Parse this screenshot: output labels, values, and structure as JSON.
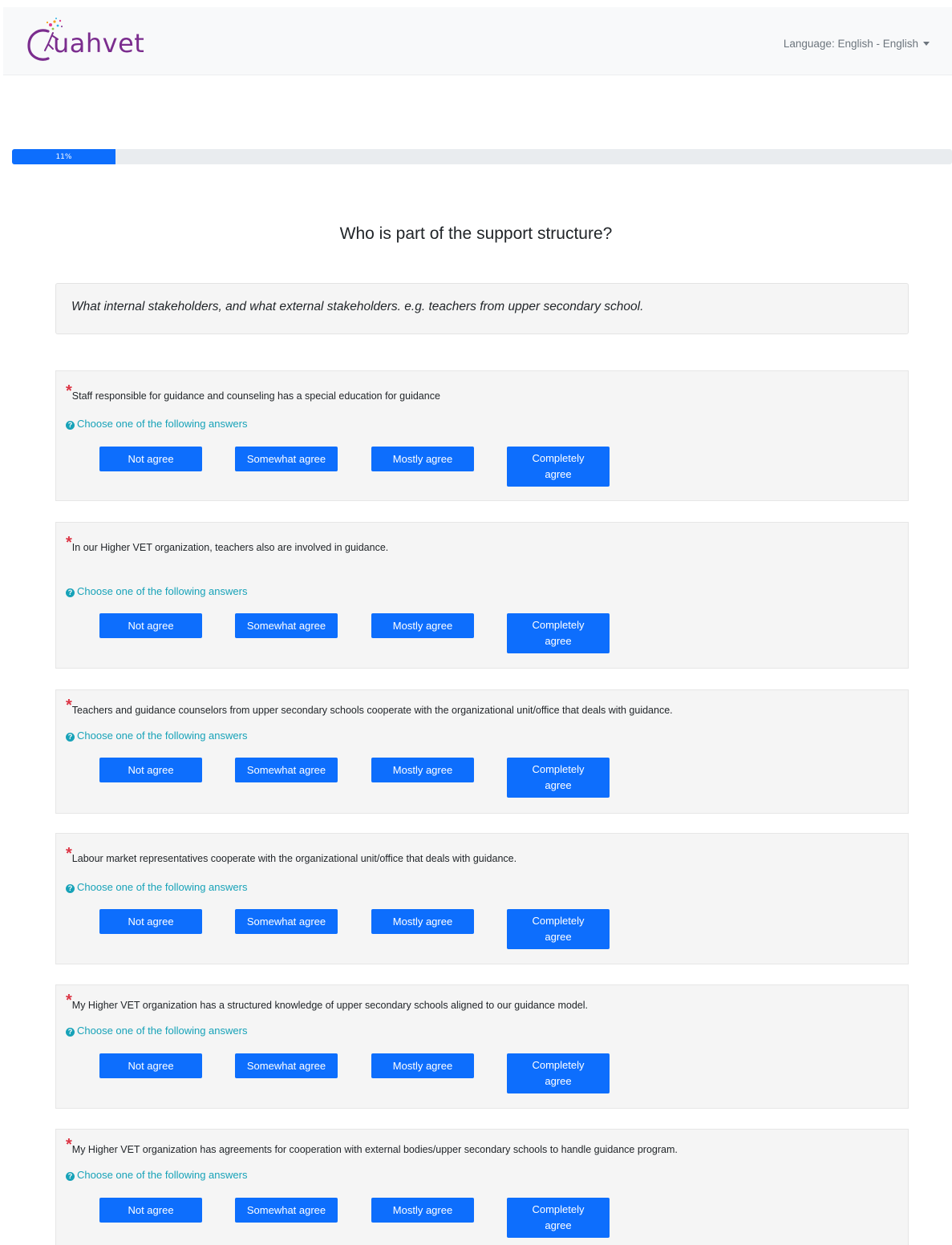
{
  "header": {
    "logo_text": "Quahvet",
    "language_label": "Language: English - English"
  },
  "progress": {
    "label": "11%",
    "percent": 11
  },
  "group": {
    "title": "Who is part of the support structure?",
    "description": "What internal stakeholders, and what external stakeholders. e.g. teachers from upper secondary school."
  },
  "answer_labels": [
    "Not agree",
    "Somewhat agree",
    "Mostly agree",
    "Completely agree"
  ],
  "help_text": "Choose one of the following answers",
  "questions": [
    {
      "required_mark": "*",
      "text": "Staff responsible for guidance and counseling has a special education for guidance",
      "answers": [
        "Not agree",
        "Somewhat agree",
        "Mostly agree",
        "Completely agree"
      ],
      "help": "Choose one of the following answers"
    },
    {
      "required_mark": "*",
      "text": "In our Higher VET organization, teachers also are involved in guidance.",
      "answers": [
        "Not agree",
        "Somewhat agree",
        "Mostly agree",
        "Completely agree"
      ],
      "help": "Choose one of the following answers"
    },
    {
      "required_mark": "*",
      "text": "Teachers and guidance counselors from upper secondary schools cooperate with the organizational unit/office that deals with guidance.",
      "answers": [
        "Not agree",
        "Somewhat agree",
        "Mostly agree",
        "Completely agree"
      ],
      "help": "Choose one of the following answers"
    },
    {
      "required_mark": "*",
      "text": "Labour market representatives cooperate with the organizational unit/office that deals with guidance.",
      "answers": [
        "Not agree",
        "Somewhat agree",
        "Mostly agree",
        "Completely agree"
      ],
      "help": "Choose one of the following answers"
    },
    {
      "required_mark": "*",
      "text": "My Higher VET organization has a structured knowledge of upper secondary schools aligned to our guidance model.",
      "answers": [
        "Not agree",
        "Somewhat agree",
        "Mostly agree",
        "Completely agree"
      ],
      "help": "Choose one of the following answers"
    },
    {
      "required_mark": "*",
      "text": "My Higher VET organization has agreements for cooperation with external bodies/upper secondary schools to handle guidance program.",
      "answers": [
        "Not agree",
        "Somewhat agree",
        "Mostly agree",
        "Completely agree"
      ],
      "help": "Choose one of the following answers"
    }
  ],
  "colors": {
    "primary": "#0d6efd",
    "help": "#17a2b8",
    "required": "#dc3545",
    "brand": "#7b2d8e"
  }
}
